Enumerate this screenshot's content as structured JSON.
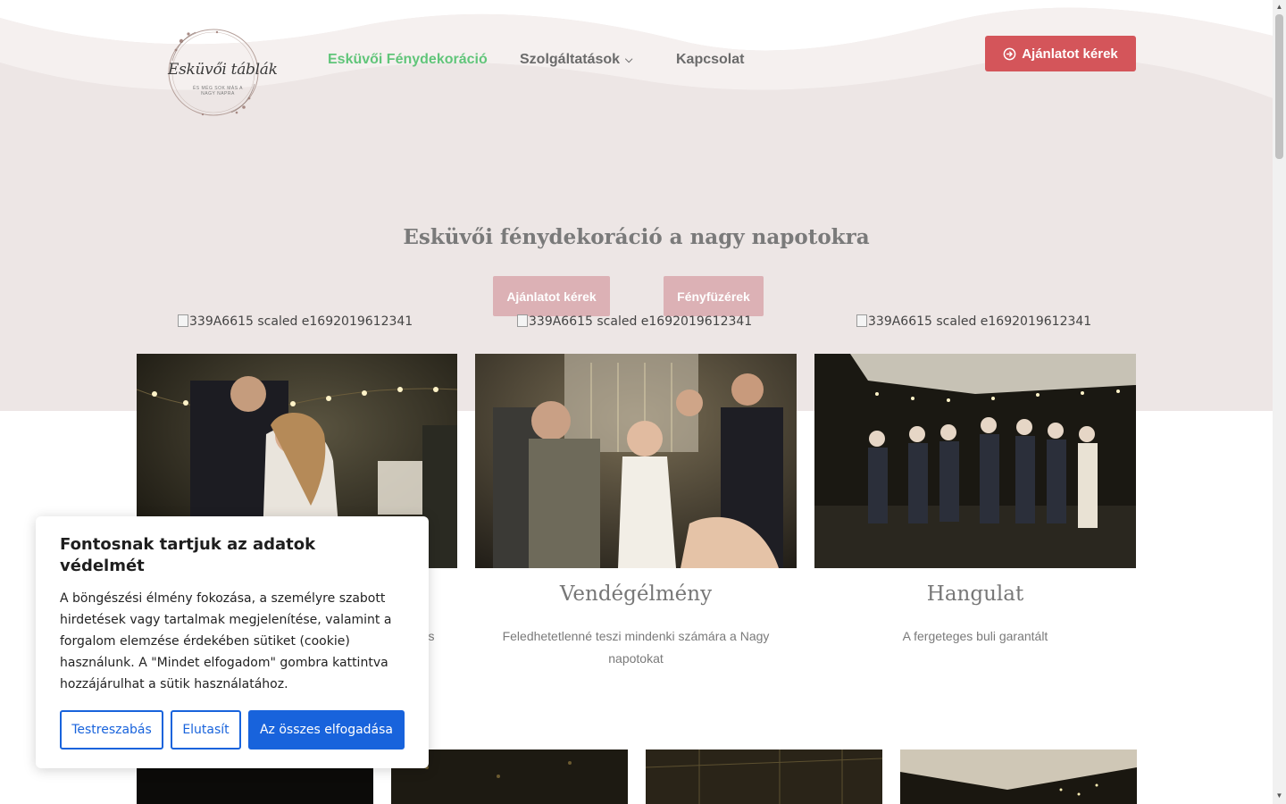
{
  "header": {
    "logo_text": "Esküvői táblák",
    "logo_subtext": "ÉS MÉG SOK MÁS A NAGY NAPRA",
    "nav": [
      {
        "label": "Esküvői Fénydekoráció",
        "active": true
      },
      {
        "label": "Szolgáltatások",
        "has_dropdown": true
      },
      {
        "label": "Kapcsolat"
      }
    ],
    "cta_label": "Ajánlatot kérek",
    "cta_icon": "arrow-circle-right-icon"
  },
  "hero": {
    "title": "Esküvői fénydekoráció a nagy napotokra",
    "buttons": [
      "Ajánlatot kérek",
      "Fényfüzérek"
    ]
  },
  "broken_images": [
    "339A6615 scaled e1692019612341",
    "339A6615 scaled e1692019612341",
    "339A6615 scaled e1692019612341"
  ],
  "columns": [
    {
      "title": "",
      "text": "us és"
    },
    {
      "title": "Vendégélmény",
      "text": "Feledhetetlenné teszi mindenki számára a Nagy napotokat"
    },
    {
      "title": "Hangulat",
      "text": "A fergeteges buli garantált"
    }
  ],
  "cookie": {
    "title": "Fontosnak tartjuk az adatok védelmét",
    "body": "A böngészési élmény fokozása, a személyre szabott hirdetések vagy tartalmak megjelenítése, valamint a forgalom elemzése érdekében sütiket (cookie) használunk. A \"Mindet elfogadom\" gombra kattintva hozzájárulhat a sütik használatához.",
    "customize_label": "Testreszabás",
    "reject_label": "Elutasít",
    "accept_label": "Az összes elfogadása"
  },
  "colors": {
    "hero_bg": "#ede6e5",
    "nav_active": "#61c57a",
    "cta": "#d4555a",
    "hero_button": "#dcb1b5",
    "cookie_blue": "#1863dc"
  }
}
